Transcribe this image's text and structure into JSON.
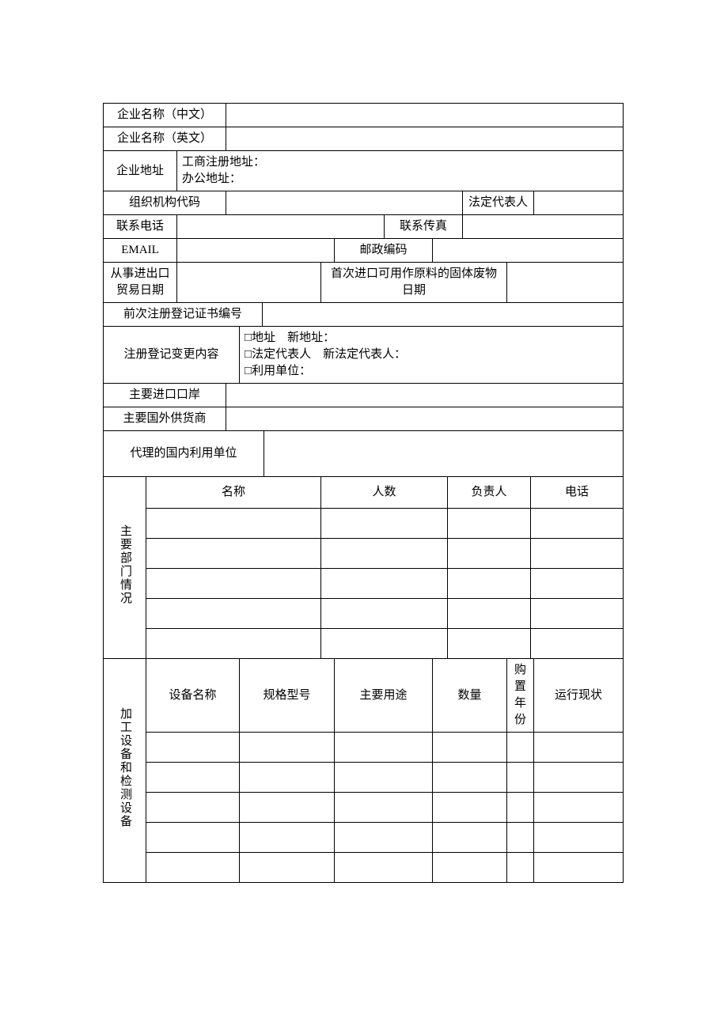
{
  "rows": {
    "company_name_cn": "企业名称（中文）",
    "company_name_en": "企业名称（英文）",
    "company_address": "企业地址",
    "business_reg_addr": "工商注册地址：",
    "office_addr": "办公地址：",
    "org_code": "组织机构代码",
    "legal_rep": "法定代表人",
    "phone": "联系电话",
    "fax": "联系传真",
    "email": "EMAIL",
    "postal": "邮政编码",
    "import_export_date": "从事进出口贸易日期",
    "first_import_date": "首次进口可用作原料的固体废物日期",
    "prev_cert_no": "前次注册登记证书编号",
    "change_content": "注册登记变更内容",
    "change_addr": "□地址　新地址：",
    "change_legal": "□法定代表人　新法定代表人：",
    "change_unit": "□利用单位：",
    "main_port": "主要进口口岸",
    "main_supplier": "主要国外供货商",
    "agent_unit": "代理的国内利用单位"
  },
  "dept": {
    "title": "主要部门情况",
    "headers": [
      "名称",
      "人数",
      "负责人",
      "电话"
    ]
  },
  "equip": {
    "title": "加工设备和检测设备",
    "headers": [
      "设备名称",
      "规格型号",
      "主要用途",
      "数量",
      "购置年份",
      "运行现状"
    ]
  }
}
